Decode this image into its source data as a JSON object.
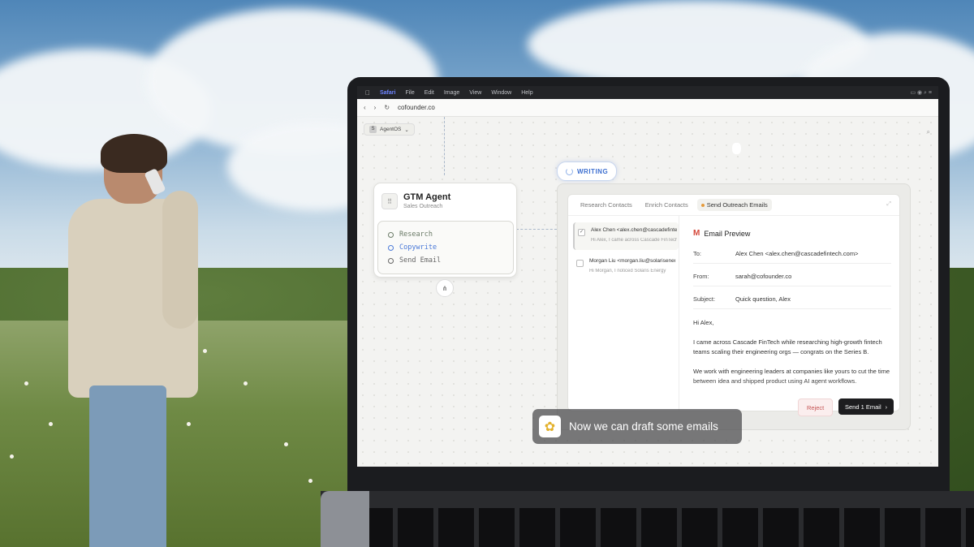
{
  "menubar": {
    "app": "Safari",
    "items": [
      "File",
      "Edit",
      "Image",
      "View",
      "Window",
      "Help"
    ]
  },
  "browser": {
    "url": "cofounder.co"
  },
  "workspace": {
    "label": "AgentOS",
    "icon_letter": "S"
  },
  "agent_card": {
    "title": "GTM Agent",
    "subtitle": "Sales Outreach",
    "steps": [
      "Research",
      "Copywrite",
      "Send Email"
    ]
  },
  "status_pill": {
    "label": "WRITING"
  },
  "outreach": {
    "tabs": [
      "Research Contacts",
      "Enrich Contacts",
      "Send Outreach Emails"
    ],
    "contacts": [
      {
        "name": "Alex Chen <alex.chen@cascadefintech.com>",
        "preview": "Hi Alex, I came across Cascade FinTech"
      },
      {
        "name": "Morgan Liu <morgan.liu@solarisenergy.com>",
        "preview": "Hi Morgan, I noticed Solaris Energy"
      }
    ],
    "preview": {
      "title": "Email Preview",
      "to_label": "To:",
      "to_value": "Alex Chen <alex.chen@cascadefintech.com>",
      "from_label": "From:",
      "from_value": "sarah@cofounder.co",
      "subject_label": "Subject:",
      "subject_value": "Quick question, Alex",
      "greeting": "Hi Alex,",
      "paragraph_1": "I came across Cascade FinTech while researching high-growth fintech teams scaling their engineering orgs — congrats on the Series B.",
      "paragraph_2": "We work with engineering leaders at companies like yours to cut the time between idea and shipped product using AI agent workflows."
    },
    "reject_label": "Reject",
    "send_label": "Send 1 Email"
  },
  "caption": {
    "text": "Now we can draft some emails"
  },
  "colors": {
    "accent_blue": "#3d6fd0",
    "send_button": "#1d1d1f",
    "reject_text": "#c65555",
    "gmail_red": "#d44638"
  }
}
